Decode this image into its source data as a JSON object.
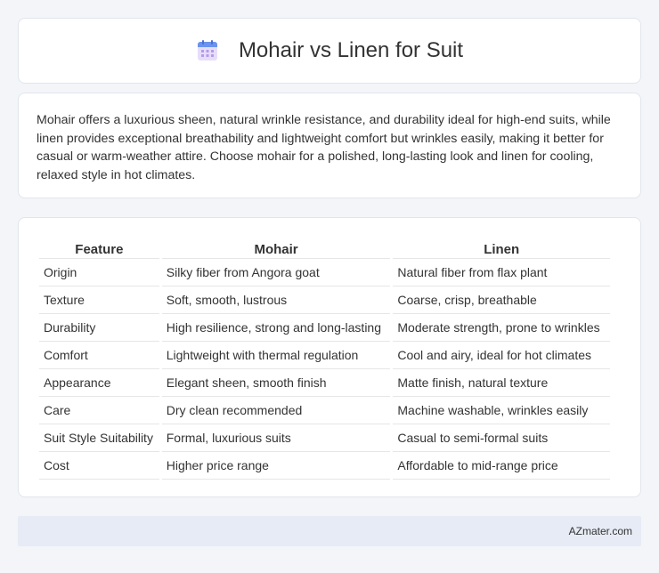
{
  "header": {
    "title": "Mohair vs Linen for Suit",
    "icon": "calendar-icon"
  },
  "description": "Mohair offers a luxurious sheen, natural wrinkle resistance, and durability ideal for high-end suits, while linen provides exceptional breathability and lightweight comfort but wrinkles easily, making it better for casual or warm-weather attire. Choose mohair for a polished, long-lasting look and linen for cooling, relaxed style in hot climates.",
  "table": {
    "headers": [
      "Feature",
      "Mohair",
      "Linen"
    ],
    "rows": [
      [
        "Origin",
        "Silky fiber from Angora goat",
        "Natural fiber from flax plant"
      ],
      [
        "Texture",
        "Soft, smooth, lustrous",
        "Coarse, crisp, breathable"
      ],
      [
        "Durability",
        "High resilience, strong and long-lasting",
        "Moderate strength, prone to wrinkles"
      ],
      [
        "Comfort",
        "Lightweight with thermal regulation",
        "Cool and airy, ideal for hot climates"
      ],
      [
        "Appearance",
        "Elegant sheen, smooth finish",
        "Matte finish, natural texture"
      ],
      [
        "Care",
        "Dry clean recommended",
        "Machine washable, wrinkles easily"
      ],
      [
        "Suit Style Suitability",
        "Formal, luxurious suits",
        "Casual to semi-formal suits"
      ],
      [
        "Cost",
        "Higher price range",
        "Affordable to mid-range price"
      ]
    ]
  },
  "footer": {
    "text": "AZmater.com"
  },
  "colors": {
    "background": "#f3f5f9",
    "card": "#ffffff",
    "footer_bg": "#e6ebf5",
    "icon_top": "#5b8def",
    "icon_body": "#c9b6f2"
  }
}
